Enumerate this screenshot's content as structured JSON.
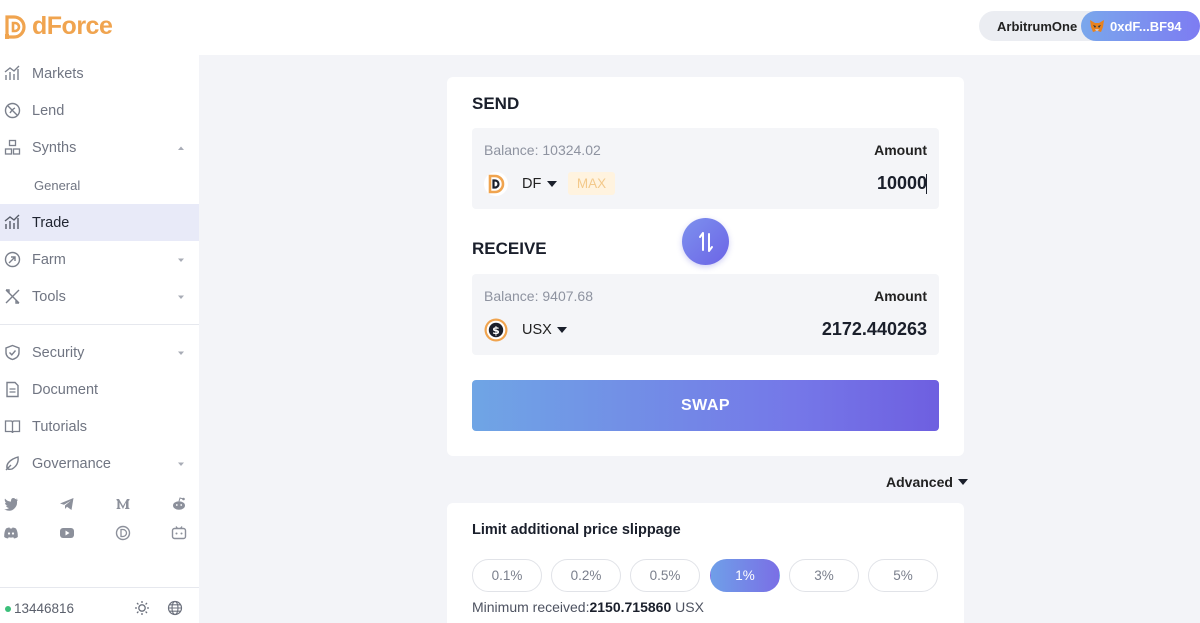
{
  "brand": {
    "name": "dForce",
    "accent": "#f0a44f"
  },
  "header": {
    "network": "ArbitrumOne",
    "wallet_address": "0xdF...BF94"
  },
  "sidebar": {
    "items": [
      {
        "label": "Markets",
        "icon": "markets-chart-icon"
      },
      {
        "label": "Lend",
        "icon": "lend-icon"
      },
      {
        "label": "Synths",
        "icon": "synths-icon",
        "expanded": true
      },
      {
        "label": "General",
        "sub": true
      },
      {
        "label": "Trade",
        "icon": "trade-chart-icon",
        "active": true
      },
      {
        "label": "Farm",
        "icon": "farm-icon"
      },
      {
        "label": "Tools",
        "icon": "tools-icon"
      },
      {
        "label": "Security",
        "icon": "shield-icon"
      },
      {
        "label": "Document",
        "icon": "document-icon"
      },
      {
        "label": "Tutorials",
        "icon": "book-icon"
      },
      {
        "label": "Governance",
        "icon": "governance-icon"
      }
    ],
    "socials": [
      "twitter-icon",
      "telegram-icon",
      "medium-icon",
      "reddit-icon",
      "discord-icon",
      "youtube-icon",
      "dforce-icon",
      "forum-icon"
    ],
    "block_number": "13446816"
  },
  "swap": {
    "send": {
      "title": "SEND",
      "balance": "Balance: 10324.02",
      "amount_label": "Amount",
      "token": "DF",
      "max_label": "MAX",
      "amount": "10000"
    },
    "receive": {
      "title": "RECEIVE",
      "balance": "Balance: 9407.68",
      "amount_label": "Amount",
      "token": "USX",
      "amount": "2172.440263"
    },
    "swap_label": "SWAP"
  },
  "advanced": {
    "label": "Advanced"
  },
  "slippage": {
    "title": "Limit additional price slippage",
    "options": [
      "0.1%",
      "0.2%",
      "0.5%",
      "1%",
      "3%",
      "5%"
    ],
    "selected": "1%",
    "min_received_label": "Minimum received:",
    "min_received_value": "2150.715860",
    "min_received_unit": "USX"
  }
}
